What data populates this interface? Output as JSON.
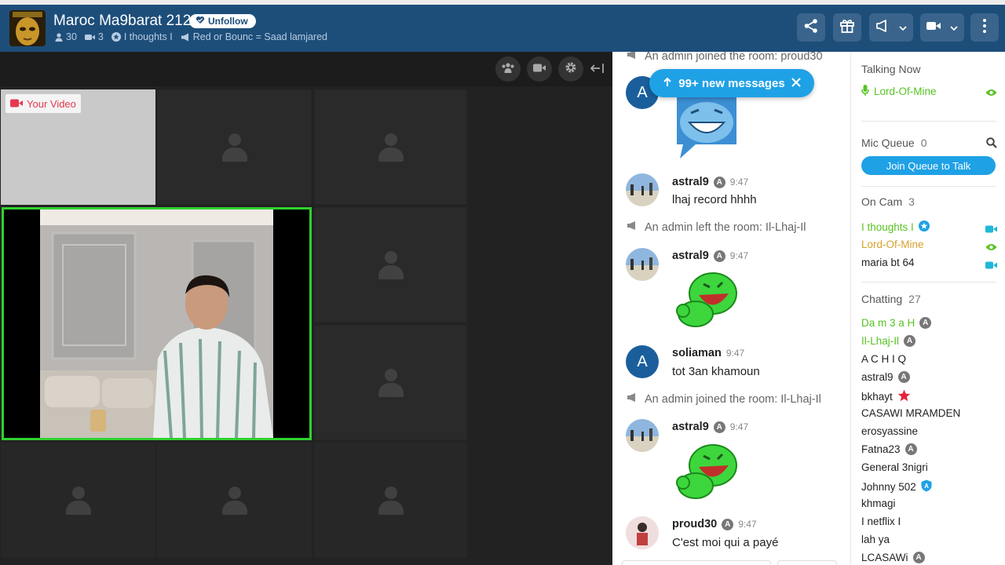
{
  "colors": {
    "header_bg": "#1d4e7a",
    "accent": "#1fa1e6",
    "active_border": "#2fd12f",
    "green_user": "#58c322",
    "gold_user": "#d8a12a"
  },
  "header": {
    "title": "Maroc Ma9barat 212",
    "unfollow_label": "Unfollow",
    "user_count": "30",
    "cam_count": "3",
    "owner": "I thoughts I",
    "topic": "Red or Bounc = Saad lamjared"
  },
  "video": {
    "your_video_label": "Your Video"
  },
  "chat": {
    "new_messages_label": "99+ new messages",
    "messages": [
      {
        "type": "system",
        "text": "An admin joined the room: proud30"
      },
      {
        "type": "user",
        "avatar_letter": "A",
        "kind": "sticker"
      },
      {
        "type": "user",
        "name": "astral9",
        "time": "9:47",
        "text": "lhaj record hhhh"
      },
      {
        "type": "system",
        "text": "An admin left the room: Il-Lhaj-Il"
      },
      {
        "type": "user",
        "name": "astral9",
        "time": "9:47",
        "kind": "sticker"
      },
      {
        "type": "user",
        "name": "soliaman",
        "time": "9:47",
        "avatar_letter": "A",
        "text": "tot 3an khamoun"
      },
      {
        "type": "system",
        "text": "An admin joined the room: Il-Lhaj-Il"
      },
      {
        "type": "user",
        "name": "astral9",
        "time": "9:47",
        "kind": "sticker"
      },
      {
        "type": "user",
        "name": "proud30",
        "time": "9:47",
        "text": "C'est moi qui a payé"
      }
    ]
  },
  "sidebar": {
    "talking_now": {
      "title": "Talking Now",
      "users": [
        "Lord-Of-Mine"
      ]
    },
    "mic_queue": {
      "title": "Mic Queue",
      "count": "0",
      "join_label": "Join Queue to Talk"
    },
    "on_cam": {
      "title": "On Cam",
      "count": "3",
      "users": [
        "I thoughts I",
        "Lord-Of-Mine",
        "maria bt 64"
      ]
    },
    "chatting": {
      "title": "Chatting",
      "count": "27",
      "users": [
        "Da m 3 a H",
        "Il-Lhaj-Il",
        "A C H I Q",
        "astral9",
        "bkhayt",
        "CASAWI MRAMDEN",
        "erosyassine",
        "Fatna23",
        "General 3nigri",
        "Johnny 502",
        "khmagi",
        "I netflix I",
        "lah ya",
        "LCASAWi"
      ]
    }
  }
}
